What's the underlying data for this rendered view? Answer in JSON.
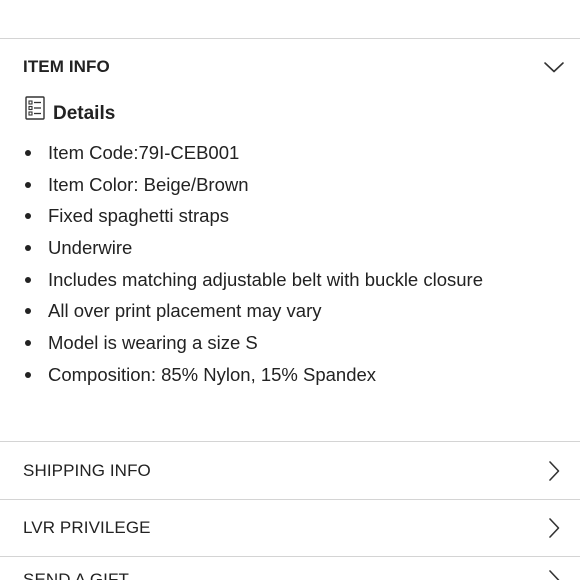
{
  "item_info": {
    "title": "ITEM INFO",
    "toggle_icon": "chevron-down-icon",
    "details_icon": "list-icon",
    "details_heading": "Details",
    "details": [
      "Item Code:79I-CEB001",
      "Item Color: Beige/Brown",
      "Fixed spaghetti straps",
      "Underwire",
      "Includes matching adjustable belt with buckle closure",
      "All over print placement may vary",
      "Model is wearing a size S",
      "Composition: 85% Nylon, 15% Spandex"
    ]
  },
  "sections": [
    {
      "label": "SHIPPING INFO",
      "icon": "chevron-right-icon"
    },
    {
      "label": "LVR PRIVILEGE",
      "icon": "chevron-right-icon"
    },
    {
      "label": "SEND A GIFT",
      "icon": "chevron-right-icon"
    }
  ]
}
